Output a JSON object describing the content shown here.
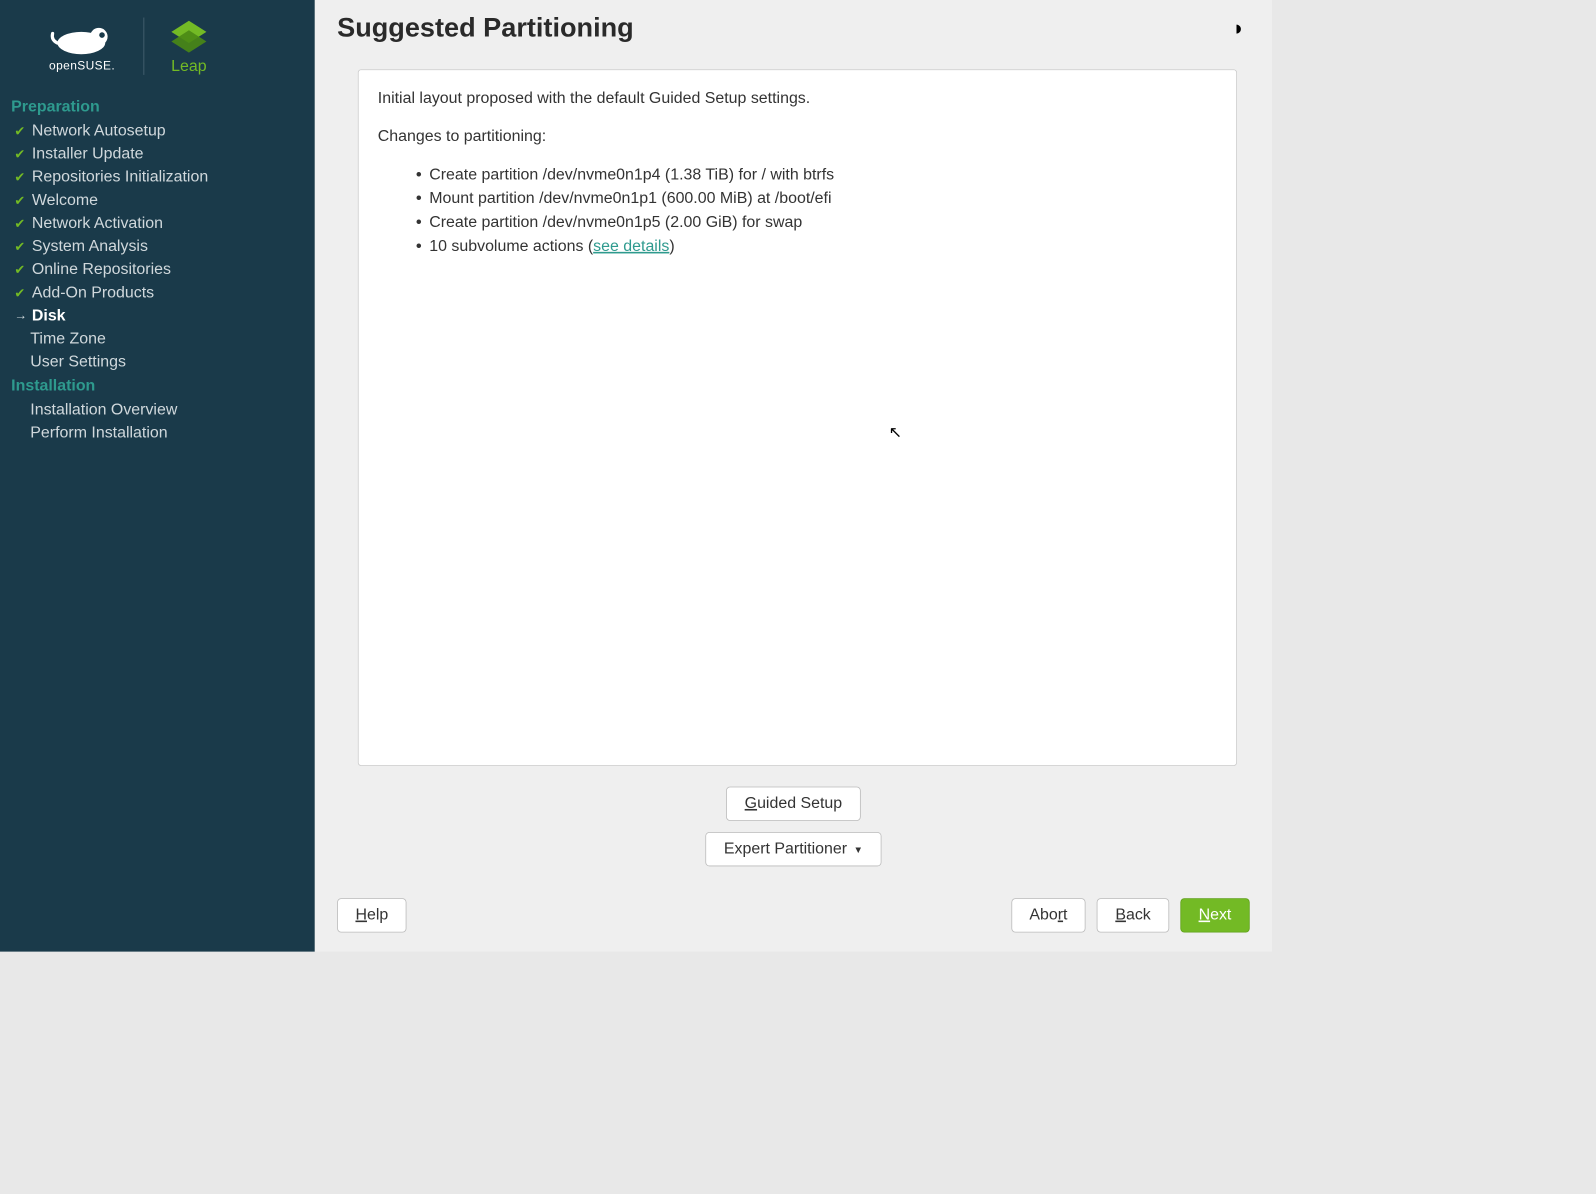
{
  "branding": {
    "distro": "openSUSE.",
    "edition": "Leap"
  },
  "sidebar": {
    "sections": [
      {
        "title": "Preparation",
        "items": [
          {
            "label": "Network Autosetup",
            "done": true
          },
          {
            "label": "Installer Update",
            "done": true
          },
          {
            "label": "Repositories Initialization",
            "done": true
          },
          {
            "label": "Welcome",
            "done": true
          },
          {
            "label": "Network Activation",
            "done": true
          },
          {
            "label": "System Analysis",
            "done": true
          },
          {
            "label": "Online Repositories",
            "done": true
          },
          {
            "label": "Add-On Products",
            "done": true
          },
          {
            "label": "Disk",
            "current": true
          },
          {
            "label": "Time Zone"
          },
          {
            "label": "User Settings"
          }
        ]
      },
      {
        "title": "Installation",
        "items": [
          {
            "label": "Installation Overview"
          },
          {
            "label": "Perform Installation"
          }
        ]
      }
    ]
  },
  "page": {
    "title": "Suggested Partitioning",
    "intro": "Initial layout proposed with the default Guided Setup settings.",
    "changes_label": "Changes to partitioning:",
    "changes": [
      "Create partition /dev/nvme0n1p4 (1.38 TiB) for / with btrfs",
      "Mount partition /dev/nvme0n1p1 (600.00 MiB) at /boot/efi",
      "Create partition /dev/nvme0n1p5 (2.00 GiB) for swap"
    ],
    "subvolume_prefix": "10 subvolume actions (",
    "subvolume_link": "see details",
    "subvolume_suffix": ")"
  },
  "buttons": {
    "guided": "Guided Setup",
    "expert": "Expert Partitioner",
    "help": "Help",
    "abort": "Abort",
    "back": "Back",
    "next": "Next"
  }
}
